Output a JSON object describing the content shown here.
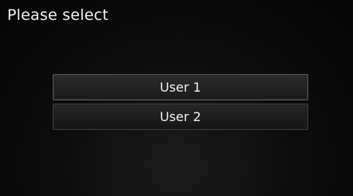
{
  "header": {
    "title": "Please select"
  },
  "options": [
    {
      "label": "User 1",
      "selected": true
    },
    {
      "label": "User 2",
      "selected": false
    }
  ]
}
